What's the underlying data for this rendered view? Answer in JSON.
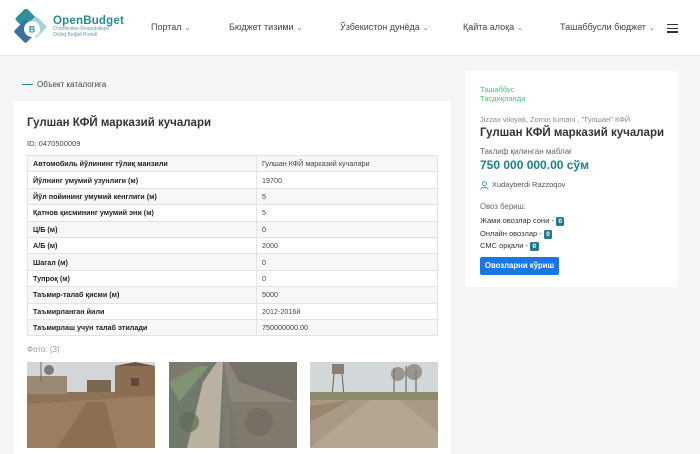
{
  "brand": {
    "name": "OpenBudget",
    "sub1": "O'zbekiston Respublikasi",
    "sub2": "Ochiq Budjet Portali"
  },
  "nav": [
    {
      "label": "Портал"
    },
    {
      "label": "Бюджет тизими"
    },
    {
      "label": "Ўзбекистон дунёда"
    },
    {
      "label": "Қайта алоқа"
    },
    {
      "label": "Ташаббусли бюджет"
    }
  ],
  "breadcrumb": "Объект каталогига",
  "object": {
    "title": "Гулшан КФЙ марказий кучалари",
    "id_text": "ID: 0470500009",
    "attributes": [
      {
        "k": "Автомобиль йўлининг тўлиқ манзили",
        "v": "Гулшан КФЙ марказий кучалари"
      },
      {
        "k": "Йўлнинг умумий узунлиги (м)",
        "v": "19700"
      },
      {
        "k": "Йўл пойининг умумий кенглиги (м)",
        "v": "5"
      },
      {
        "k": "Қатнов қисмининг умумий эни (м)",
        "v": "5"
      },
      {
        "k": "Ц/Б (м)",
        "v": "0"
      },
      {
        "k": "А/Б (м)",
        "v": "2000"
      },
      {
        "k": "Шагал (м)",
        "v": "0"
      },
      {
        "k": "Тупроқ (м)",
        "v": "0"
      },
      {
        "k": "Таъмир-талаб қисми (м)",
        "v": "5000"
      },
      {
        "k": "Таъмирланган йили",
        "v": "2012-2016й"
      },
      {
        "k": "Таъмирлаш учун талаб этилади",
        "v": "750000000.00"
      }
    ],
    "photos_label": "Фото: (3)"
  },
  "side": {
    "status_line1": "Ташаббус",
    "status_line2": "Тасдиқланди",
    "location": "Jizzax viloyati, Zomin tumani , \"Гулшан\" КФЙ",
    "title": "Гулшан КФЙ марказий кучалари",
    "amount_label": "Таклиф қилинган маблағ",
    "amount": "750 000 000.00 сўм",
    "author": "Xudayberdi Razzoqov",
    "votes_title": "Овоз бериш:",
    "votes": [
      {
        "label": "Жами овозлар сони -",
        "count": "0"
      },
      {
        "label": "Онлайн овозлар -",
        "count": "0"
      },
      {
        "label": "СМС орқали -",
        "count": "0"
      }
    ],
    "vote_button": "Овозларни кўриш"
  },
  "colors": {
    "accent": "#1d7f89",
    "button": "#1877e5",
    "status": "#4bbf7a"
  },
  "icons": [
    "logo-icon",
    "chevron-down-icon",
    "menu-icon",
    "user-icon"
  ]
}
